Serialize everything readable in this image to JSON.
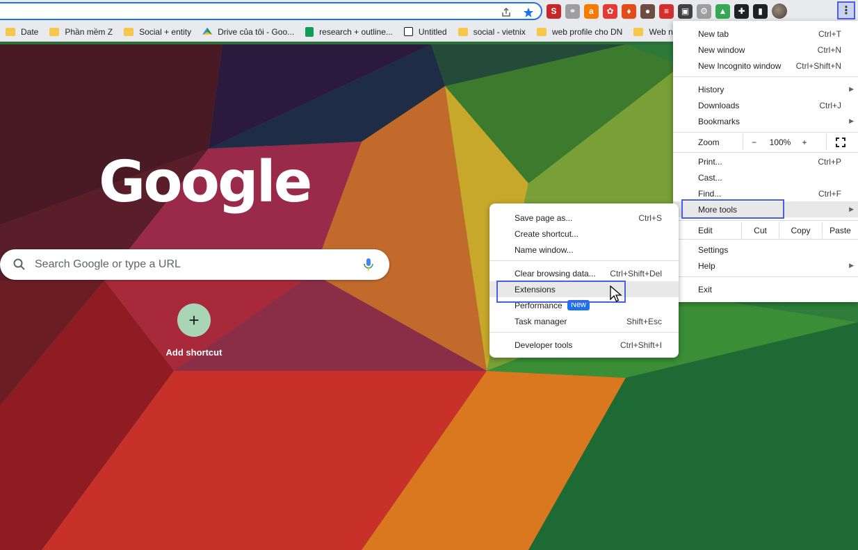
{
  "toolbar": {
    "share_icon": "share-icon",
    "star_icon": "star-icon",
    "extensions": [
      {
        "name": "extension-icon-1",
        "color": "#c62828",
        "glyph": "S"
      },
      {
        "name": "extension-icon-2",
        "color": "#9e9e9e",
        "glyph": "⚭"
      },
      {
        "name": "extension-icon-3",
        "color": "#f57c00",
        "glyph": "a"
      },
      {
        "name": "extension-icon-4",
        "color": "#e53935",
        "glyph": "✿"
      },
      {
        "name": "extension-icon-5",
        "color": "#e64a19",
        "glyph": "♦"
      },
      {
        "name": "extension-icon-6",
        "color": "#6d4c41",
        "glyph": "●"
      },
      {
        "name": "extension-icon-7",
        "color": "#d32f2f",
        "glyph": "≡"
      },
      {
        "name": "extension-icon-8",
        "color": "#424242",
        "glyph": "▣"
      },
      {
        "name": "extension-icon-9",
        "color": "#9e9e9e",
        "glyph": "⚙"
      },
      {
        "name": "drive-extension-icon",
        "color": "#34a853",
        "glyph": "▲"
      },
      {
        "name": "puzzle-icon",
        "color": "#202124",
        "glyph": "✚"
      },
      {
        "name": "sidepanel-icon",
        "color": "#202124",
        "glyph": "▮"
      }
    ],
    "menu_icon": "⋮"
  },
  "bookmarks": [
    {
      "label": "Date",
      "icon": "folder"
    },
    {
      "label": "Phần mềm Z",
      "icon": "folder"
    },
    {
      "label": "Social + entity",
      "icon": "folder"
    },
    {
      "label": "Drive của tôi - Goo...",
      "icon": "drive"
    },
    {
      "label": "research + outline...",
      "icon": "sheets"
    },
    {
      "label": "Untitled",
      "icon": "notion"
    },
    {
      "label": "social - vietnix",
      "icon": "folder"
    },
    {
      "label": "web profile cho DN",
      "icon": "folder"
    },
    {
      "label": "Web n",
      "icon": "folder"
    }
  ],
  "ntp": {
    "logo": "Google",
    "search_placeholder": "Search Google or type a URL",
    "add_shortcut_label": "Add shortcut",
    "add_glyph": "+"
  },
  "main_menu": {
    "new_tab": "New tab",
    "new_tab_sc": "Ctrl+T",
    "new_window": "New window",
    "new_window_sc": "Ctrl+N",
    "incognito": "New Incognito window",
    "incognito_sc": "Ctrl+Shift+N",
    "history": "History",
    "downloads": "Downloads",
    "downloads_sc": "Ctrl+J",
    "bookmarks": "Bookmarks",
    "zoom": "Zoom",
    "zoom_minus": "−",
    "zoom_value": "100%",
    "zoom_plus": "+",
    "print": "Print...",
    "print_sc": "Ctrl+P",
    "cast": "Cast...",
    "find": "Find...",
    "find_sc": "Ctrl+F",
    "more_tools": "More tools",
    "edit": "Edit",
    "cut": "Cut",
    "copy": "Copy",
    "paste": "Paste",
    "settings": "Settings",
    "help": "Help",
    "exit": "Exit"
  },
  "more_tools_menu": {
    "save_page": "Save page as...",
    "save_page_sc": "Ctrl+S",
    "create_shortcut": "Create shortcut...",
    "name_window": "Name window...",
    "clear_data": "Clear browsing data...",
    "clear_data_sc": "Ctrl+Shift+Del",
    "extensions": "Extensions",
    "performance": "Performance",
    "performance_badge": "New",
    "task_manager": "Task manager",
    "task_manager_sc": "Shift+Esc",
    "dev_tools": "Developer tools",
    "dev_tools_sc": "Ctrl+Shift+I"
  },
  "colors": {
    "accent": "#1a73e8",
    "highlight_box": "#4a5ee0"
  }
}
